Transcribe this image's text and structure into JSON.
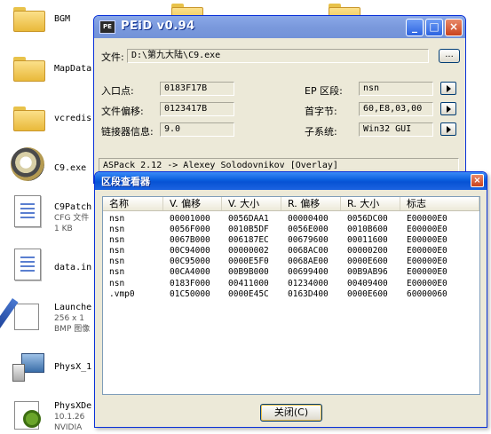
{
  "desktop": {
    "items": [
      {
        "label": "BGM",
        "icon": "folder-icon"
      },
      {
        "label": "MapData",
        "icon": "folder-icon"
      },
      {
        "label": "vcredis",
        "icon": "folder-icon"
      },
      {
        "label": "C9.exe",
        "icon": "c9-app-icon"
      },
      {
        "label": "C9Patch",
        "sub1": "CFG 文件",
        "sub2": "1 KB",
        "icon": "cfg-file-icon"
      },
      {
        "label": "data.in",
        "icon": "ini-file-icon"
      },
      {
        "label": "Launche",
        "sub1": "256 x 1",
        "sub2": "BMP 图像",
        "icon": "bmp-image-icon"
      },
      {
        "label": "PhysX_1",
        "icon": "installer-icon"
      },
      {
        "label": "PhysXDe",
        "sub1": "10.1.26",
        "sub2": "NVIDIA",
        "icon": "physx-app-icon"
      }
    ]
  },
  "peid": {
    "title": "PEiD v0.94",
    "icon_text": "PE",
    "file_label": "文件:",
    "file_value": "D:\\第九大陆\\C9.exe",
    "browse_label": "...",
    "entry_label": "入口点:",
    "entry_value": "0183F17B",
    "offset_label": "文件偏移:",
    "offset_value": "0123417B",
    "linker_label": "链接器信息:",
    "linker_value": "9.0",
    "ep_section_label": "EP 区段:",
    "ep_section_value": "nsn",
    "first_bytes_label": "首字节:",
    "first_bytes_value": "60,E8,03,00",
    "subsystem_label": "子系统:",
    "subsystem_value": "Win32 GUI",
    "detection": "ASPack 2.12 -> Alexey Solodovnikov [Overlay]"
  },
  "section_viewer": {
    "title": "区段查看器",
    "columns": [
      "名称",
      "V. 偏移",
      "V. 大小",
      "R. 偏移",
      "R. 大小",
      "标志"
    ],
    "rows": [
      [
        "nsn",
        "00001000",
        "0056DAA1",
        "00000400",
        "0056DC00",
        "E00000E0"
      ],
      [
        "nsn",
        "0056F000",
        "0010B5DF",
        "0056E000",
        "0010B600",
        "E00000E0"
      ],
      [
        "nsn",
        "0067B000",
        "006187EC",
        "00679600",
        "00011600",
        "E00000E0"
      ],
      [
        "nsn",
        "00C94000",
        "00000002",
        "0068AC00",
        "00000200",
        "E00000E0"
      ],
      [
        "nsn",
        "00C95000",
        "0000E5F0",
        "0068AE00",
        "0000E600",
        "E00000E0"
      ],
      [
        "nsn",
        "00CA4000",
        "00B9B000",
        "00699400",
        "00B9AB96",
        "E00000E0"
      ],
      [
        "nsn",
        "0183F000",
        "00411000",
        "01234000",
        "00409400",
        "E00000E0"
      ],
      [
        ".vmp0",
        "01C50000",
        "0000E45C",
        "0163D400",
        "0000E600",
        "60000060"
      ]
    ],
    "close_label": "关闭(C)"
  },
  "colors": {
    "titlebar_active": "#0a5ddc",
    "window_face": "#ece9d8",
    "close_button": "#c9421d"
  }
}
